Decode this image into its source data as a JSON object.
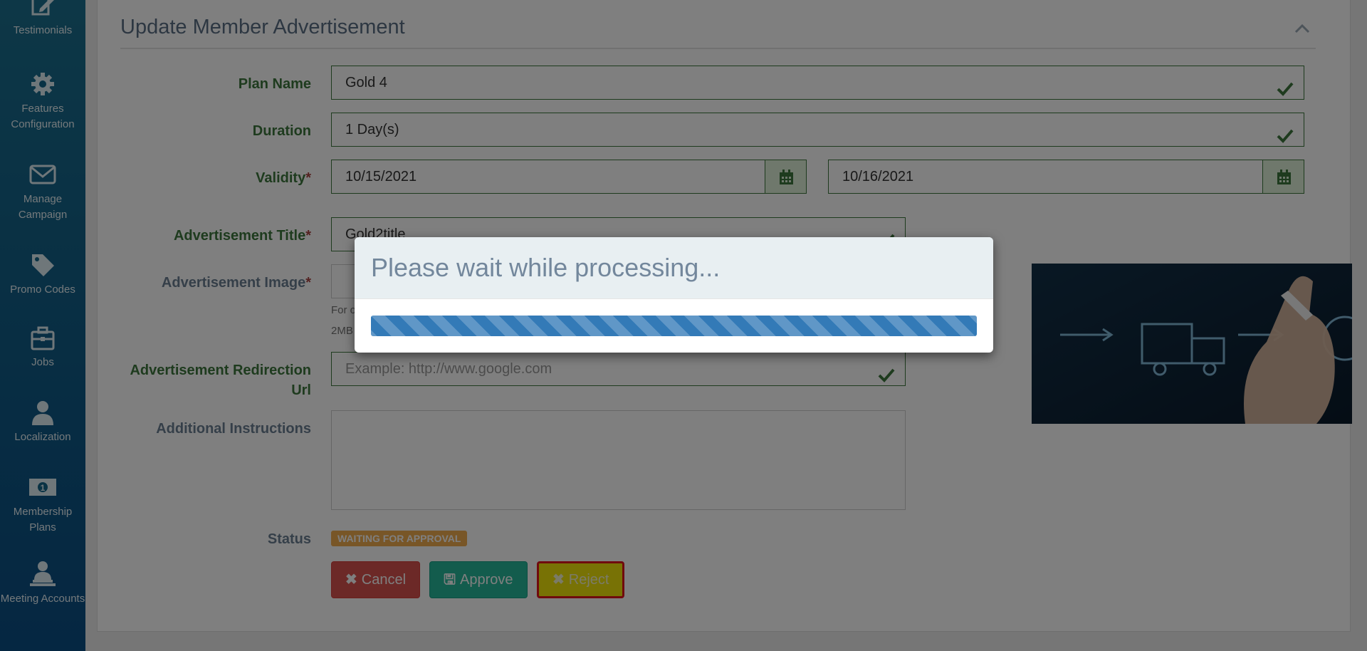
{
  "sidebar": {
    "items": [
      {
        "label": "Testimonials",
        "icon": "edit-icon"
      },
      {
        "label": "Features Configuration",
        "icon": "gear-icon"
      },
      {
        "label": "Manage Campaign",
        "icon": "envelope-icon"
      },
      {
        "label": "Promo Codes",
        "icon": "tag-icon"
      },
      {
        "label": "Jobs",
        "icon": "briefcase-icon"
      },
      {
        "label": "Localization",
        "icon": "user-icon"
      },
      {
        "label": "Membership Plans",
        "icon": "money-icon"
      },
      {
        "label": "Meeting Accounts",
        "icon": "user-laptop-icon"
      }
    ]
  },
  "panel": {
    "title": "Update Member Advertisement"
  },
  "form": {
    "plan_name_label": "Plan Name",
    "plan_name_value": "Gold 4",
    "duration_label": "Duration",
    "duration_value": "1 Day(s)",
    "validity_label": "Validity",
    "required_mark": "*",
    "validity_start": "10/15/2021",
    "validity_end": "10/16/2021",
    "ad_title_label": "Advertisement Title",
    "ad_title_value": "Gold2title",
    "ad_image_label": "Advertisement Image",
    "ad_image_hint_1": "For o",
    "ad_image_hint_2": "2MB",
    "redirect_label_1": "Advertisement Redirection",
    "redirect_label_2": "Url",
    "redirect_placeholder": "Example: http://www.google.com",
    "instructions_label": "Additional Instructions",
    "status_label": "Status",
    "status_value": "WAITING FOR APPROVAL"
  },
  "buttons": {
    "cancel": "Cancel",
    "approve": "Approve",
    "reject": "Reject"
  },
  "modal": {
    "title": "Please wait while processing...",
    "progress": 1.0
  },
  "colors": {
    "valid_green": "#3c763d",
    "status_badge": "#f0ad4e",
    "progress_blue": "#337ab7",
    "sidebar": "#0f5a86"
  }
}
